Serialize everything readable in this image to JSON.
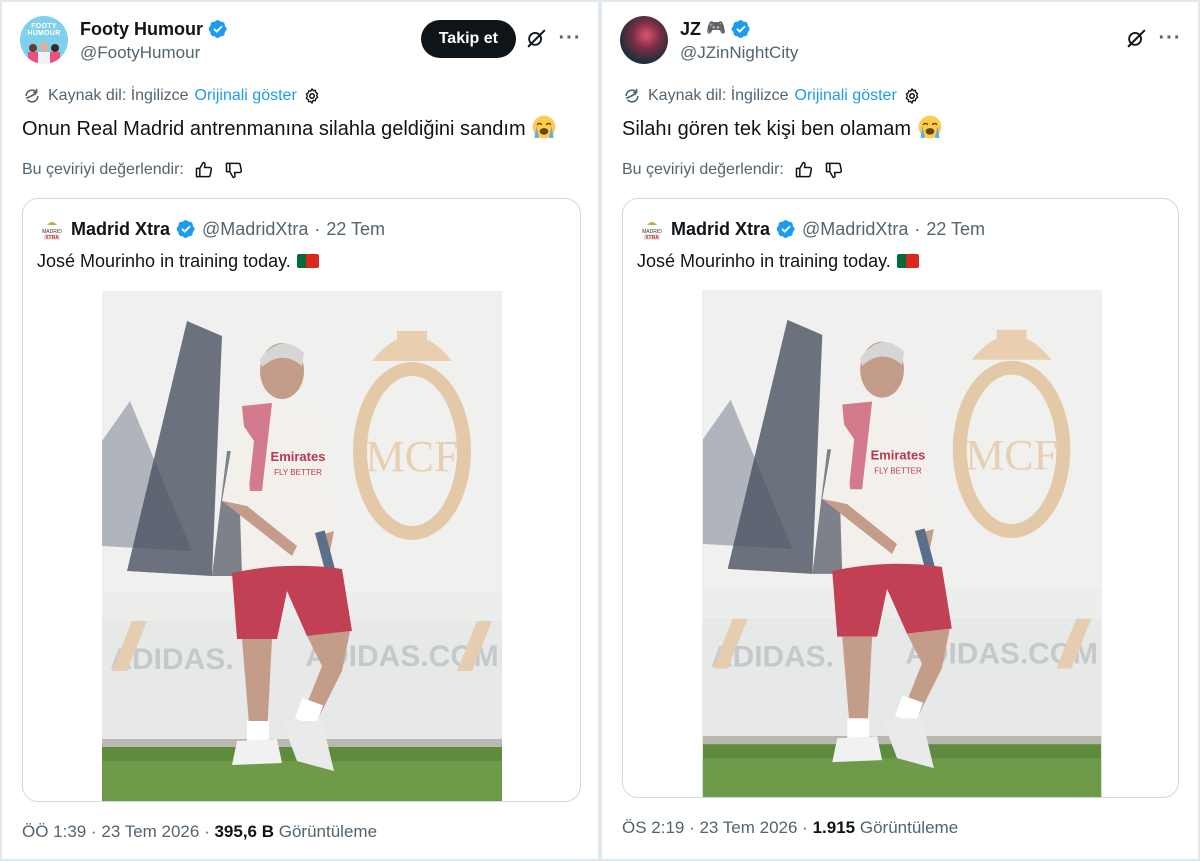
{
  "colors": {
    "accent": "#1d9bf0",
    "text": "#0f1419",
    "secondary": "#536471",
    "border": "#cfd9de",
    "follow_button_bg": "#0f1419",
    "verified": "#1d9bf0"
  },
  "posts": [
    {
      "author": {
        "name": "Footy Humour",
        "handle": "@FootyHumour",
        "verified": true,
        "avatar_text": "FOOTY HUMOUR"
      },
      "follow_label": "Takip et",
      "translation": {
        "source_label": "Kaynak dil: İngilizce",
        "show_original": "Orijinali göster"
      },
      "text": "Onun Real Madrid antrenmanına silahla geldiğini sandım",
      "emoji": "😭",
      "rate_label": "Bu çeviriyi değerlendir:",
      "quote": {
        "name": "Madrid Xtra",
        "handle": "@MadridXtra",
        "separator": "·",
        "date": "22 Tem",
        "text": "José Mourinho in training today.",
        "photo_text": {
          "sponsor": "Emirates",
          "sponsor_sub": "FLY BETTER",
          "board_left": "ADIDAS.",
          "board_right": "ADIDAS.COM"
        }
      },
      "footer": {
        "time_date": "ÖÖ 1:39 · 23 Tem 2026 ·",
        "views": "395,6 B",
        "views_label": "Görüntüleme"
      }
    },
    {
      "author": {
        "name": "JZ",
        "name_emoji": "🎮",
        "handle": "@JZinNightCity",
        "verified": true
      },
      "translation": {
        "source_label": "Kaynak dil: İngilizce",
        "show_original": "Orijinali göster"
      },
      "text": "Silahı gören tek kişi ben olamam",
      "emoji": "😭",
      "rate_label": "Bu çeviriyi değerlendir:",
      "quote": {
        "name": "Madrid Xtra",
        "handle": "@MadridXtra",
        "separator": "·",
        "date": "22 Tem",
        "text": "José Mourinho in training today.",
        "photo_text": {
          "sponsor": "Emirates",
          "sponsor_sub": "FLY BETTER",
          "board_left": "ADIDAS.",
          "board_right": "ADIDAS.COM"
        }
      },
      "footer": {
        "time_date": "ÖS 2:19 · 23 Tem 2026 ·",
        "views": "1.915",
        "views_label": "Görüntüleme"
      }
    }
  ],
  "icons": [
    "verified-badge-icon",
    "grok-icon",
    "more-icon",
    "translate-icon",
    "settings-gear-icon",
    "thumbs-up-icon",
    "thumbs-down-icon",
    "portugal-flag-icon",
    "loudly-crying-emoji-icon"
  ]
}
